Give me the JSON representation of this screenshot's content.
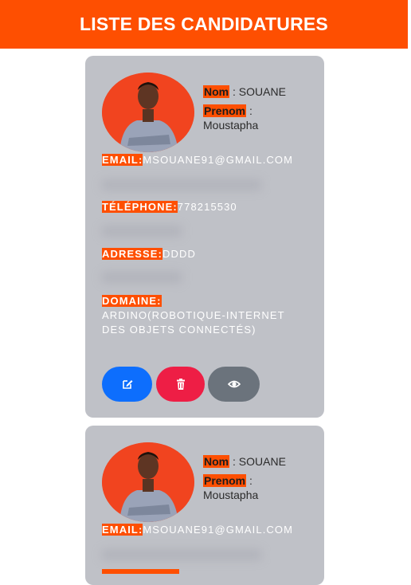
{
  "header": {
    "title": "LISTE DES CANDIDATURES"
  },
  "labels": {
    "nom": "Nom",
    "prenom": "Prenom",
    "email": "EMAIL:",
    "telephone": "TÉLÉPHONE:",
    "adresse": "ADRESSE:",
    "domaine": "DOMAINE:"
  },
  "candidates": [
    {
      "nom": "SOUANE",
      "prenom": "Moustapha",
      "email": "MSOUANE91@GMAIL.COM",
      "telephone": "778215530",
      "adresse": "DDDD",
      "domaine": "ARDINO(ROBOTIQUE-INTERNET DES OBJETS CONNECTÉS)"
    },
    {
      "nom": "SOUANE",
      "prenom": "Moustapha",
      "email": "MSOUANE91@GMAIL.COM"
    }
  ],
  "actions": {
    "edit_icon": "edit-icon",
    "delete_icon": "trash-icon",
    "view_icon": "eye-icon"
  },
  "colors": {
    "accent": "#fe4f01",
    "card": "#bfc1c7",
    "edit": "#0d6efd",
    "delete": "#ee1e45",
    "view": "#6b737c"
  }
}
